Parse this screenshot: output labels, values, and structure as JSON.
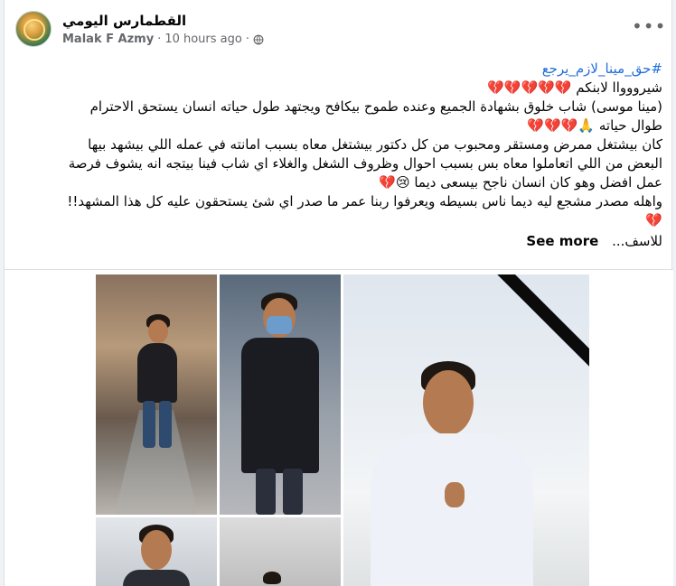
{
  "post": {
    "page_name": "القطمارس اليومي",
    "author": "Malak F Azmy",
    "time": "10 hours ago",
    "separator": "·",
    "more_icon": "•••",
    "privacy_icon": "globe-icon"
  },
  "text": {
    "hashtag": "#حق_مينا_لازم_يرجع",
    "line1": "شيرووواا لابنكم 💔💔💔💔💔",
    "line2": "(مينا موسى) شاب خلوق بشهادة الجميع وعنده طموح بيكافح ويجتهد طول حياته انسان يستحق الاحترام",
    "line3": "طوال حياته 🙏💔💔💔",
    "line4": "كان بيشتغل ممرض ومستقر ومحبوب من كل دكتور بيشتغل معاه بسبب امانته في عمله اللي بيشهد بيها",
    "line5": "البعض من اللي اتعاملوا معاه بس بسبب احوال وظروف الشغل والغلاء اي شاب فينا بيتجه انه يشوف فرصة",
    "line6": "عمل افضل وهو كان انسان ناجح بيسعى ديما 😢💔",
    "line7": "واهله مصدر مشجع ليه ديما ناس بسيطه ويعرفوا ربنا عمر ما صدر اي شئ يستحقون عليه كل هذا المشهد!!",
    "line8": "💔",
    "line9": "للاسف...",
    "see_more": "See more"
  }
}
